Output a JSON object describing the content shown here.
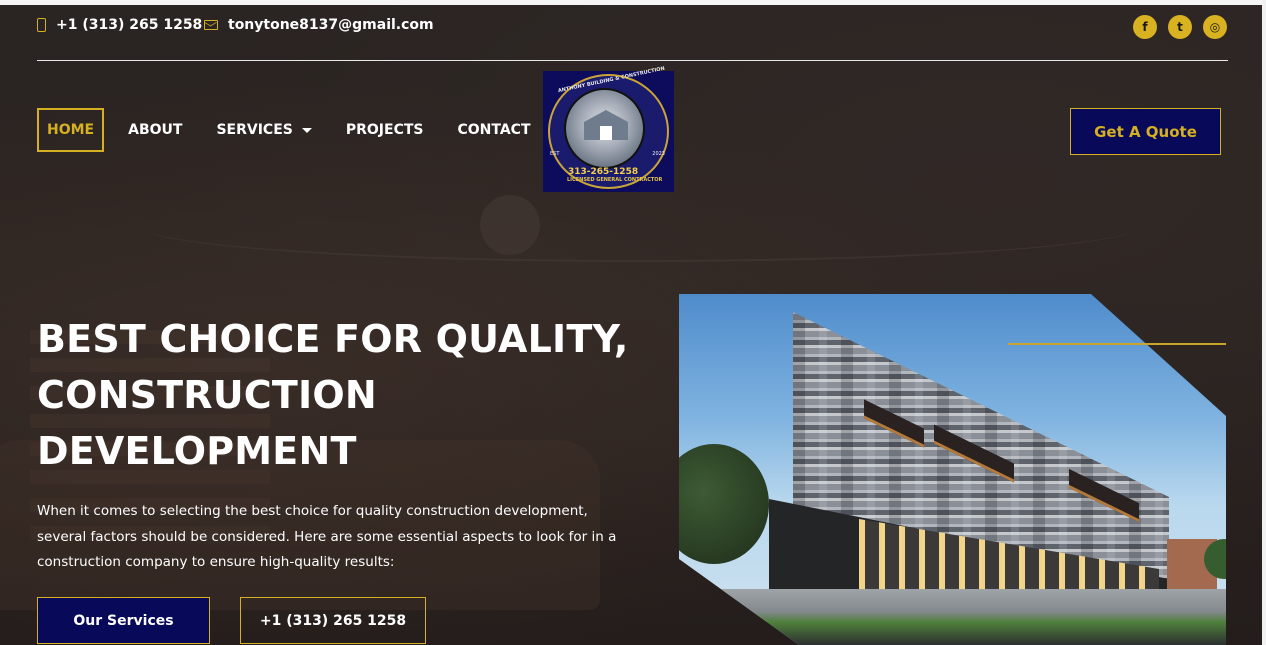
{
  "topbar": {
    "phone": "+1 (313) 265 1258",
    "email": "tonytone8137@gmail.com",
    "socials": [
      {
        "name": "facebook-icon",
        "glyph": "f"
      },
      {
        "name": "twitter-icon",
        "glyph": "t"
      },
      {
        "name": "instagram-icon",
        "glyph": "◎"
      }
    ]
  },
  "nav": {
    "items": [
      {
        "label": "HOME",
        "active": true
      },
      {
        "label": "ABOUT"
      },
      {
        "label": "SERVICES",
        "has_dropdown": true
      },
      {
        "label": "PROJECTS"
      },
      {
        "label": "CONTACT"
      }
    ],
    "cta_label": "Get A Quote"
  },
  "logo": {
    "top_text": "ANTHONY BUILDING & CONSTRUCTION",
    "phone_text": "313-265-1258",
    "license_text": "LICENSED GENERAL CONTRACTOR",
    "est_label": "EST",
    "year": "2023"
  },
  "hero": {
    "title_lines": [
      "BEST CHOICE FOR QUALITY,",
      "CONSTRUCTION",
      "DEVELOPMENT"
    ],
    "text": "When it comes to selecting the best choice for quality construction development, several factors should be considered. Here are some essential aspects to look for in a construction company to ensure high-quality results:",
    "primary_button": "Our Services",
    "secondary_button": "+1 (313) 265 1258"
  },
  "colors": {
    "accent_gold": "#d4b022",
    "navy": "#09095a",
    "background": "#231e1c"
  }
}
